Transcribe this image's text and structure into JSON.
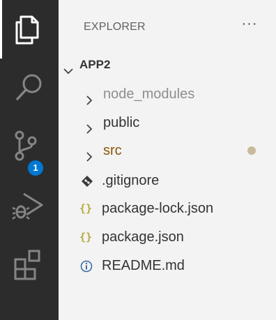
{
  "activity_bar": {
    "items": [
      {
        "icon": "files-icon",
        "active": true
      },
      {
        "icon": "search-icon",
        "active": false
      },
      {
        "icon": "source-control-icon",
        "active": false,
        "badge": "1"
      },
      {
        "icon": "run-debug-icon",
        "active": false
      },
      {
        "icon": "extensions-icon",
        "active": false
      }
    ],
    "badge_color": "#0078d4"
  },
  "sidebar": {
    "title": "EXPLORER",
    "more_actions": "···",
    "root": {
      "label": "APP2",
      "expanded": true
    },
    "items": [
      {
        "label": "node_modules",
        "kind": "folder",
        "ignored": true
      },
      {
        "label": "public",
        "kind": "folder"
      },
      {
        "label": "src",
        "kind": "folder",
        "modified": true
      },
      {
        "label": ".gitignore",
        "kind": "file",
        "icon": "git-icon"
      },
      {
        "label": "package-lock.json",
        "kind": "file",
        "icon": "json-braces-icon",
        "icon_text": "{}"
      },
      {
        "label": "package.json",
        "kind": "file",
        "icon": "json-braces-icon",
        "icon_text": "{}"
      },
      {
        "label": "README.md",
        "kind": "file",
        "icon": "info-icon"
      }
    ]
  },
  "colors": {
    "activity_bar_bg": "#2c2c2c",
    "sidebar_bg": "#f3f3f3",
    "modified_folder": "#895503",
    "ignored_text": "#8e8e8e",
    "json_icon": "#b8a93c"
  }
}
